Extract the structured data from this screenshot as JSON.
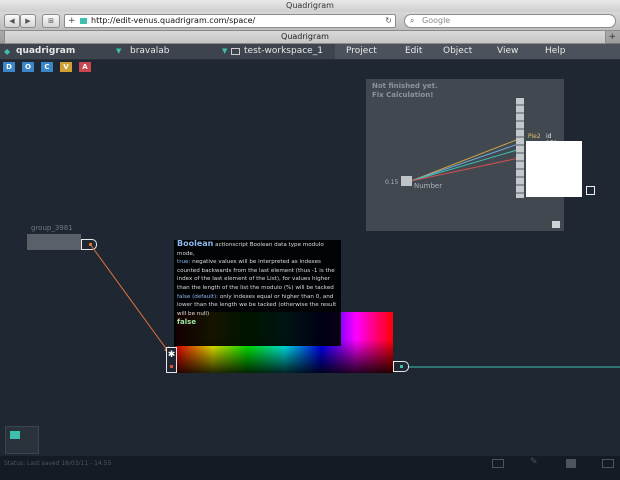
{
  "browser": {
    "window_title": "Quadrigram",
    "url": "http://edit-venus.quadrigram.com/space/",
    "search_placeholder": "Google",
    "tab_title": "Quadrigram",
    "new_tab": "+"
  },
  "app": {
    "logo": "quadrigram",
    "workspace_user": "bravalab",
    "workspace_name": "test-workspace_1",
    "menu": [
      "Project",
      "Edit",
      "Object",
      "View",
      "Help"
    ],
    "side_tabs": [
      {
        "label": "D",
        "color": "#3a86c8"
      },
      {
        "label": "O",
        "color": "#3a86c8"
      },
      {
        "label": "C",
        "color": "#3a86c8"
      },
      {
        "label": "V",
        "color": "#d1a032"
      },
      {
        "label": "A",
        "color": "#c8464f"
      }
    ]
  },
  "panel": {
    "message_line1": "Not finished yet.",
    "message_line2": "Fix Calculation!",
    "node_value": "0.15",
    "node_label": "Number",
    "pie_label": "Pie2",
    "pie_id": "id 279"
  },
  "group": {
    "label": "group_3981"
  },
  "tooltip": {
    "title": "Boolean",
    "desc": "actionscript Boolean data type modulo mode,",
    "true_key": "true:",
    "true_text": "negative values will be interpreted as indexes counted backwards from the last element (thus -1 is the index of the last element of the List), for values higher than the length of the list the modulo (%) will be tacked",
    "false_key": "false (default):",
    "false_text": "only indexes equal or higher than 0, and lower than the length we be tacked (otherwise the result will be null)",
    "value": "false"
  },
  "status": {
    "text": "Status: Last saved 18/03/11 - 14:55"
  },
  "colors": {
    "stage": "#1f2832",
    "link_orange": "#e0703a",
    "link_teal": "#3fbfae"
  }
}
